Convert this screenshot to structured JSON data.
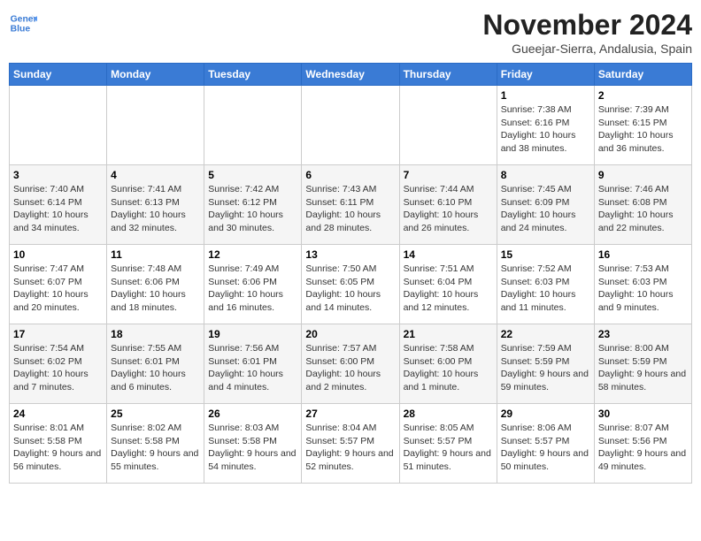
{
  "header": {
    "logo_line1": "General",
    "logo_line2": "Blue",
    "title": "November 2024",
    "subtitle": "Gueejar-Sierra, Andalusia, Spain"
  },
  "weekdays": [
    "Sunday",
    "Monday",
    "Tuesday",
    "Wednesday",
    "Thursday",
    "Friday",
    "Saturday"
  ],
  "weeks": [
    [
      {
        "day": "",
        "info": ""
      },
      {
        "day": "",
        "info": ""
      },
      {
        "day": "",
        "info": ""
      },
      {
        "day": "",
        "info": ""
      },
      {
        "day": "",
        "info": ""
      },
      {
        "day": "1",
        "info": "Sunrise: 7:38 AM\nSunset: 6:16 PM\nDaylight: 10 hours and 38 minutes."
      },
      {
        "day": "2",
        "info": "Sunrise: 7:39 AM\nSunset: 6:15 PM\nDaylight: 10 hours and 36 minutes."
      }
    ],
    [
      {
        "day": "3",
        "info": "Sunrise: 7:40 AM\nSunset: 6:14 PM\nDaylight: 10 hours and 34 minutes."
      },
      {
        "day": "4",
        "info": "Sunrise: 7:41 AM\nSunset: 6:13 PM\nDaylight: 10 hours and 32 minutes."
      },
      {
        "day": "5",
        "info": "Sunrise: 7:42 AM\nSunset: 6:12 PM\nDaylight: 10 hours and 30 minutes."
      },
      {
        "day": "6",
        "info": "Sunrise: 7:43 AM\nSunset: 6:11 PM\nDaylight: 10 hours and 28 minutes."
      },
      {
        "day": "7",
        "info": "Sunrise: 7:44 AM\nSunset: 6:10 PM\nDaylight: 10 hours and 26 minutes."
      },
      {
        "day": "8",
        "info": "Sunrise: 7:45 AM\nSunset: 6:09 PM\nDaylight: 10 hours and 24 minutes."
      },
      {
        "day": "9",
        "info": "Sunrise: 7:46 AM\nSunset: 6:08 PM\nDaylight: 10 hours and 22 minutes."
      }
    ],
    [
      {
        "day": "10",
        "info": "Sunrise: 7:47 AM\nSunset: 6:07 PM\nDaylight: 10 hours and 20 minutes."
      },
      {
        "day": "11",
        "info": "Sunrise: 7:48 AM\nSunset: 6:06 PM\nDaylight: 10 hours and 18 minutes."
      },
      {
        "day": "12",
        "info": "Sunrise: 7:49 AM\nSunset: 6:06 PM\nDaylight: 10 hours and 16 minutes."
      },
      {
        "day": "13",
        "info": "Sunrise: 7:50 AM\nSunset: 6:05 PM\nDaylight: 10 hours and 14 minutes."
      },
      {
        "day": "14",
        "info": "Sunrise: 7:51 AM\nSunset: 6:04 PM\nDaylight: 10 hours and 12 minutes."
      },
      {
        "day": "15",
        "info": "Sunrise: 7:52 AM\nSunset: 6:03 PM\nDaylight: 10 hours and 11 minutes."
      },
      {
        "day": "16",
        "info": "Sunrise: 7:53 AM\nSunset: 6:03 PM\nDaylight: 10 hours and 9 minutes."
      }
    ],
    [
      {
        "day": "17",
        "info": "Sunrise: 7:54 AM\nSunset: 6:02 PM\nDaylight: 10 hours and 7 minutes."
      },
      {
        "day": "18",
        "info": "Sunrise: 7:55 AM\nSunset: 6:01 PM\nDaylight: 10 hours and 6 minutes."
      },
      {
        "day": "19",
        "info": "Sunrise: 7:56 AM\nSunset: 6:01 PM\nDaylight: 10 hours and 4 minutes."
      },
      {
        "day": "20",
        "info": "Sunrise: 7:57 AM\nSunset: 6:00 PM\nDaylight: 10 hours and 2 minutes."
      },
      {
        "day": "21",
        "info": "Sunrise: 7:58 AM\nSunset: 6:00 PM\nDaylight: 10 hours and 1 minute."
      },
      {
        "day": "22",
        "info": "Sunrise: 7:59 AM\nSunset: 5:59 PM\nDaylight: 9 hours and 59 minutes."
      },
      {
        "day": "23",
        "info": "Sunrise: 8:00 AM\nSunset: 5:59 PM\nDaylight: 9 hours and 58 minutes."
      }
    ],
    [
      {
        "day": "24",
        "info": "Sunrise: 8:01 AM\nSunset: 5:58 PM\nDaylight: 9 hours and 56 minutes."
      },
      {
        "day": "25",
        "info": "Sunrise: 8:02 AM\nSunset: 5:58 PM\nDaylight: 9 hours and 55 minutes."
      },
      {
        "day": "26",
        "info": "Sunrise: 8:03 AM\nSunset: 5:58 PM\nDaylight: 9 hours and 54 minutes."
      },
      {
        "day": "27",
        "info": "Sunrise: 8:04 AM\nSunset: 5:57 PM\nDaylight: 9 hours and 52 minutes."
      },
      {
        "day": "28",
        "info": "Sunrise: 8:05 AM\nSunset: 5:57 PM\nDaylight: 9 hours and 51 minutes."
      },
      {
        "day": "29",
        "info": "Sunrise: 8:06 AM\nSunset: 5:57 PM\nDaylight: 9 hours and 50 minutes."
      },
      {
        "day": "30",
        "info": "Sunrise: 8:07 AM\nSunset: 5:56 PM\nDaylight: 9 hours and 49 minutes."
      }
    ]
  ]
}
